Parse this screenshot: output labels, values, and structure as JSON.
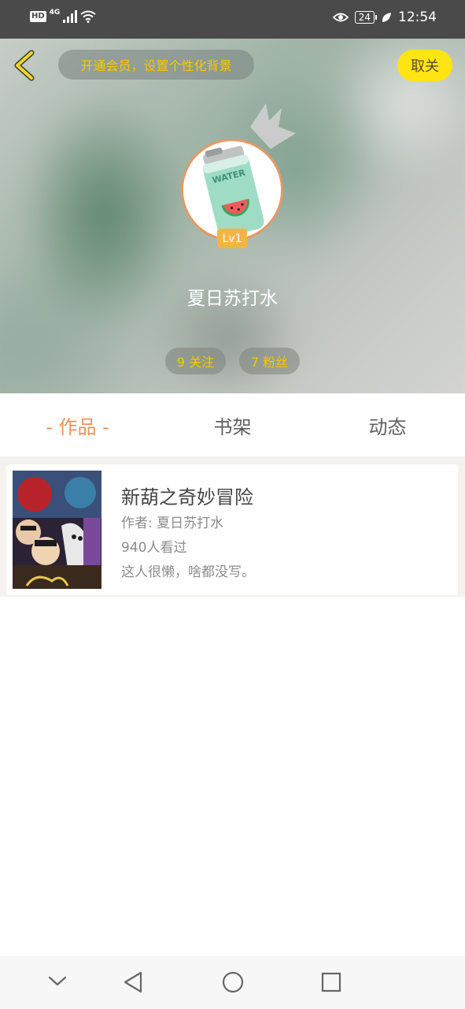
{
  "status_bar": {
    "hd": "HD",
    "network": "4G",
    "battery": "24",
    "time": "12:54"
  },
  "header": {
    "vip_prompt": "开通会员，设置个性化背景",
    "follow_label": "取关",
    "username": "夏日苏打水",
    "level": "Lv1",
    "stats": {
      "following": "9 关注",
      "fans": "7 粉丝"
    }
  },
  "tabs": [
    {
      "label": "- 作品 -",
      "active": true
    },
    {
      "label": "书架",
      "active": false
    },
    {
      "label": "动态",
      "active": false
    }
  ],
  "works": [
    {
      "title": "新葫之奇妙冒险",
      "author": "作者: 夏日苏打水",
      "views": "940人看过",
      "description": "这人很懒，啥都没写。"
    }
  ],
  "colors": {
    "accent": "#e8935c",
    "vip_text": "#f5c900",
    "follow_button": "#ffe413",
    "status_bar": "#4a4a4a"
  },
  "icons": {
    "back": "chevron-left-icon",
    "crown": "crown-icon",
    "nav": [
      "chevron-down-icon",
      "back-triangle-icon",
      "home-circle-icon",
      "recents-square-icon"
    ]
  }
}
